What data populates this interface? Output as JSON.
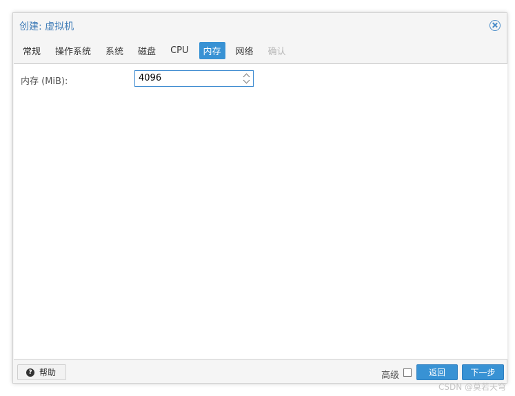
{
  "dialog": {
    "title": "创建: 虚拟机",
    "close_icon": "close-circle-icon"
  },
  "tabs": [
    {
      "label": "常规",
      "state": "normal"
    },
    {
      "label": "操作系统",
      "state": "normal"
    },
    {
      "label": "系统",
      "state": "normal"
    },
    {
      "label": "磁盘",
      "state": "normal"
    },
    {
      "label": "CPU",
      "state": "normal"
    },
    {
      "label": "内存",
      "state": "active"
    },
    {
      "label": "网络",
      "state": "normal"
    },
    {
      "label": "确认",
      "state": "disabled"
    }
  ],
  "memory": {
    "label": "内存 (MiB):",
    "value": "4096"
  },
  "footer": {
    "help_label": "帮助",
    "help_icon": "question-circle-icon",
    "advanced_label": "高级",
    "advanced_checked": false,
    "back_label": "返回",
    "next_label": "下一步"
  },
  "watermark": "CSDN @莫若天穹",
  "colors": {
    "accent": "#3892d4",
    "title": "#3c7ab6",
    "disabled": "#b8b8b8"
  }
}
